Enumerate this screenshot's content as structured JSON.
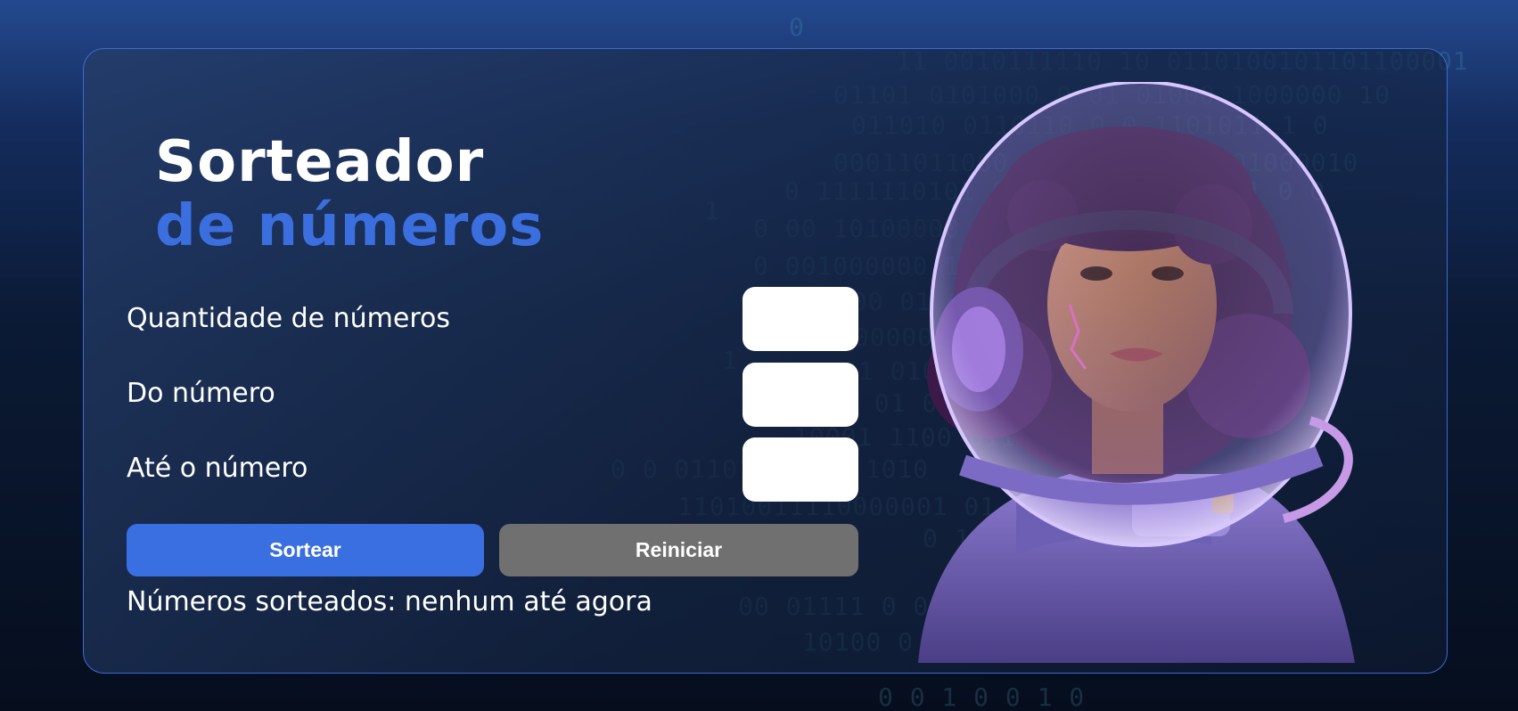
{
  "title": {
    "line1": "Sorteador",
    "line2": "de números"
  },
  "form": {
    "quantity_label": "Quantidade de números",
    "quantity_value": "",
    "from_label": "Do número",
    "from_value": "",
    "to_label": "Até o número",
    "to_value": ""
  },
  "buttons": {
    "draw_label": "Sortear",
    "reset_label": "Reiniciar"
  },
  "result": {
    "text": "Números sorteados: nenhum até agora"
  },
  "colors": {
    "accent": "#3a6fe1",
    "secondary_button": "#707070",
    "card_border": "#3b6ad6"
  },
  "illustration": {
    "subject": "astronaut-girl-with-headphones-icon"
  }
}
